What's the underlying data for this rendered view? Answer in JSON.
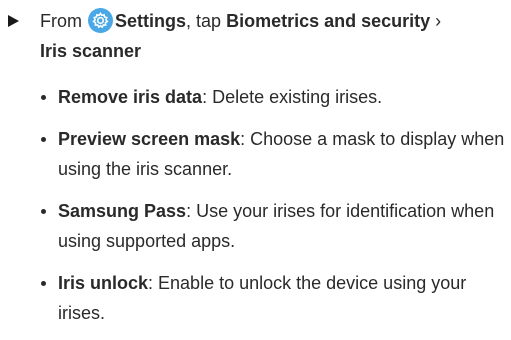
{
  "step": {
    "prefix": "From",
    "settings_label": "Settings",
    "tap_text": ", tap",
    "biometrics_label": "Biometrics and security",
    "separator": " ›",
    "iris_scanner_label": "Iris scanner",
    "settings_icon": "gear-icon"
  },
  "items": [
    {
      "term": "Remove iris data",
      "desc": ": Delete existing irises."
    },
    {
      "term": "Preview screen mask",
      "desc": ": Choose a mask to display when using the iris scanner."
    },
    {
      "term": "Samsung Pass",
      "desc": ": Use your irises for identification when using supported apps."
    },
    {
      "term": "Iris unlock",
      "desc": ": Enable to unlock the device using your irises."
    }
  ],
  "colors": {
    "settings_icon_bg": "#4aa8e6",
    "text": "#2a2a2a"
  }
}
